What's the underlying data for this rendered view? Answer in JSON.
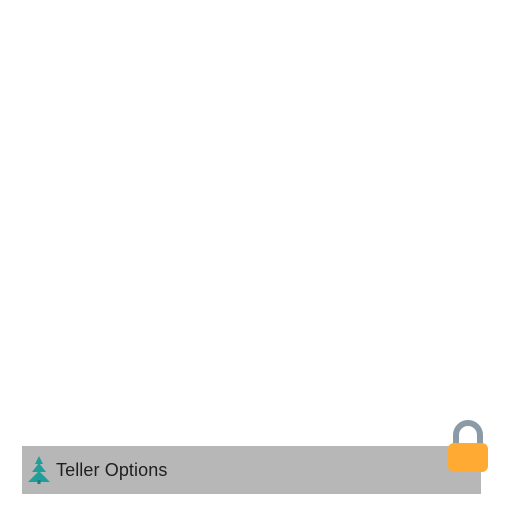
{
  "app": {
    "title": "Teller Options",
    "logo_icon": "tree-logo-icon",
    "lock_icon": "padlock-icon"
  },
  "colors": {
    "bar_background": "#b7b7b7",
    "logo_teal": "#1f9e9a",
    "lock_body": "#ffaa33",
    "lock_shackle": "#8a9aa6"
  }
}
